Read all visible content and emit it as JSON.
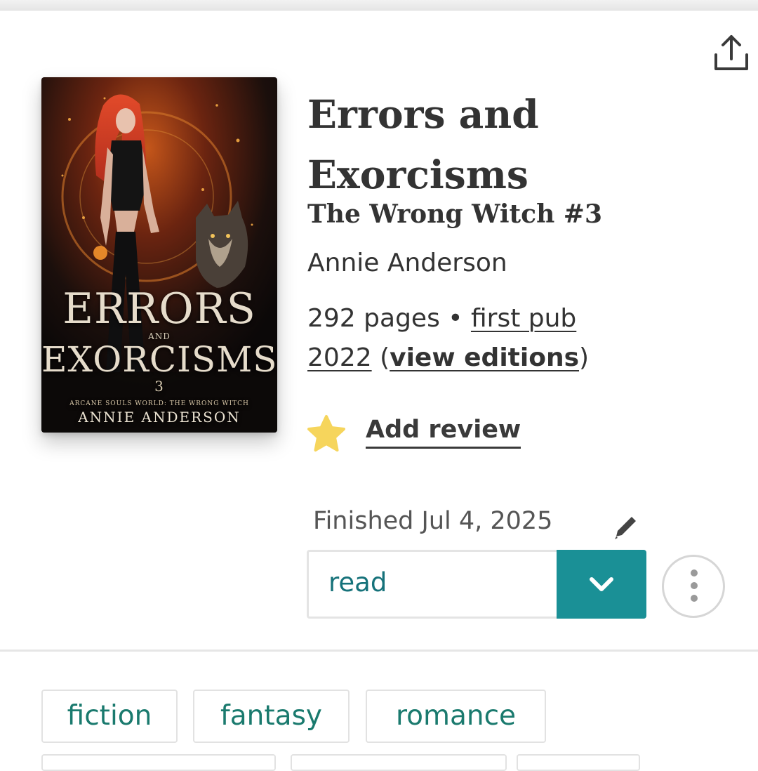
{
  "book": {
    "title_line1": "Errors and",
    "title_line2": "Exorcisms",
    "series": "The Wrong Witch #3",
    "author": "Annie Anderson",
    "pages": "292 pages",
    "bullet": "•",
    "first_pub": "first pub 2022",
    "view_editions": "view editions"
  },
  "cover": {
    "title_line1": "ERRORS",
    "title_and": "AND",
    "title_line2": "EXORCISMS",
    "number": "3",
    "series_text": "ARCANE SOULS WORLD: THE WRONG WITCH",
    "author_text": "ANNIE ANDERSON"
  },
  "review": {
    "label": "Add review",
    "star_color": "#f6d55c"
  },
  "status": {
    "finished": "Finished Jul 4, 2025",
    "shelf_value": "read",
    "accent": "#1a9096"
  },
  "tags": [
    "fiction",
    "fantasy",
    "romance"
  ],
  "icons": [
    "share-icon",
    "star-icon",
    "pencil-icon",
    "chevron-down-icon",
    "more-vertical-icon"
  ]
}
